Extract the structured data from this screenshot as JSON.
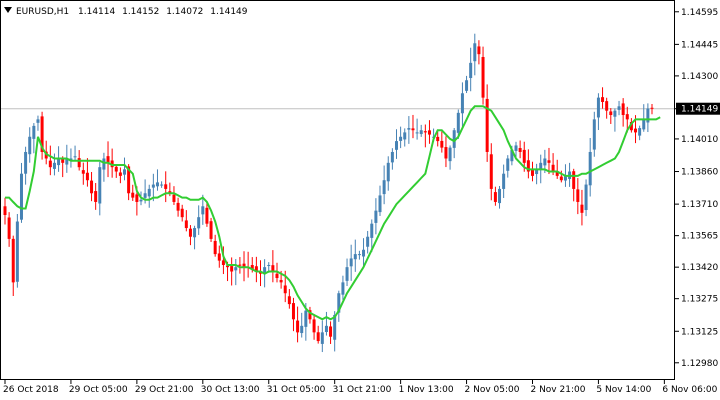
{
  "header": {
    "dropdown_icon": "triangle-down-icon",
    "symbol": "EURUSD,H1",
    "open": "1.14114",
    "high": "1.14152",
    "low": "1.14072",
    "close": "1.14149"
  },
  "colors": {
    "background": "#ffffff",
    "frame": "#000000",
    "bull_candle": "#4682b4",
    "bear_candle": "#ff0000",
    "moving_average": "#32cd32",
    "bid_line": "#c0c0c0",
    "price_label_bg": "#000000",
    "price_label_text": "#ffffff"
  },
  "chart_data": {
    "type": "candlestick",
    "title": "EURUSD,H1",
    "grid": false,
    "ylim": [
      1.1291,
      1.1464
    ],
    "y_ticks": [
      "1.14595",
      "1.14445",
      "1.14300",
      "1.14149",
      "1.14010",
      "1.13860",
      "1.13710",
      "1.13565",
      "1.13420",
      "1.13275",
      "1.13125",
      "1.12980"
    ],
    "y_tick_values": [
      1.14595,
      1.14445,
      1.143,
      1.14149,
      1.1401,
      1.1386,
      1.1371,
      1.13565,
      1.1342,
      1.13275,
      1.13125,
      1.1298
    ],
    "x_ticks": [
      "26 Oct 2018",
      "29 Oct 05:00",
      "29 Oct 21:00",
      "30 Oct 13:00",
      "31 Oct 05:00",
      "31 Oct 21:00",
      "1 Nov 13:00",
      "2 Nov 05:00",
      "2 Nov 21:00",
      "5 Nov 14:00",
      "6 Nov 06:00"
    ],
    "x_tick_bars": [
      0,
      16,
      32,
      48,
      64,
      80,
      96,
      112,
      128,
      144,
      160
    ],
    "current_price": "1.14149",
    "series": [
      {
        "kind": "close_path",
        "values": [
          1.1366,
          1.1355,
          1.1335,
          1.1363,
          1.1385,
          1.1395,
          1.1402,
          1.1407,
          1.141,
          1.1395,
          1.1392,
          1.1388,
          1.139,
          1.1392,
          1.139,
          1.1392,
          1.1392,
          1.1393,
          1.1388,
          1.1385,
          1.1382,
          1.1376,
          1.1372,
          1.1388,
          1.1392,
          1.139,
          1.1388,
          1.1386,
          1.1384,
          1.1387,
          1.1376,
          1.1374,
          1.1372,
          1.1373,
          1.1376,
          1.1378,
          1.138,
          1.1381,
          1.138,
          1.1378,
          1.1376,
          1.1372,
          1.1368,
          1.1365,
          1.136,
          1.1356,
          1.136,
          1.1365,
          1.137,
          1.1362,
          1.1355,
          1.1348,
          1.1345,
          1.1343,
          1.1342,
          1.134,
          1.1342,
          1.1343,
          1.1342,
          1.1342,
          1.1341,
          1.134,
          1.1339,
          1.1342,
          1.1343,
          1.134,
          1.1337,
          1.1335,
          1.133,
          1.1325,
          1.1318,
          1.1312,
          1.1315,
          1.1322,
          1.1318,
          1.1312,
          1.1308,
          1.1312,
          1.1315,
          1.131,
          1.132,
          1.133,
          1.1335,
          1.1342,
          1.1346,
          1.1348,
          1.1348,
          1.135,
          1.1356,
          1.1362,
          1.1368,
          1.1375,
          1.1382,
          1.139,
          1.1395,
          1.14,
          1.1402,
          1.1404,
          1.1406,
          1.1405,
          1.1404,
          1.1405,
          1.1404,
          1.1403,
          1.1402,
          1.14,
          1.1397,
          1.1392,
          1.1397,
          1.1405,
          1.1413,
          1.1422,
          1.1428,
          1.1436,
          1.1445,
          1.144,
          1.142,
          1.1395,
          1.1378,
          1.1372,
          1.1378,
          1.1385,
          1.1392,
          1.1396,
          1.1398,
          1.1395,
          1.139,
          1.1386,
          1.1384,
          1.1387,
          1.139,
          1.1392,
          1.139,
          1.1386,
          1.1384,
          1.1382,
          1.1384,
          1.1386,
          1.1378,
          1.1372,
          1.1367,
          1.138,
          1.1395,
          1.141,
          1.142,
          1.1418,
          1.1414,
          1.1412,
          1.1414,
          1.1416,
          1.1412,
          1.141,
          1.1405,
          1.1404,
          1.1406,
          1.141,
          1.1415,
          1.14149
        ]
      },
      {
        "kind": "moving_average",
        "values": [
          1.1374,
          1.1374,
          1.1372,
          1.137,
          1.1369,
          1.1369,
          1.1377,
          1.1386,
          1.1402,
          1.1397,
          1.1394,
          1.1393,
          1.1392,
          1.1392,
          1.1392,
          1.1392,
          1.1391,
          1.1391,
          1.1391,
          1.1391,
          1.1391,
          1.1391,
          1.1391,
          1.1391,
          1.139,
          1.139,
          1.1389,
          1.1389,
          1.1389,
          1.1389,
          1.1387,
          1.1385,
          1.1377,
          1.1374,
          1.1373,
          1.1373,
          1.1374,
          1.1374,
          1.1375,
          1.1376,
          1.1376,
          1.1376,
          1.1375,
          1.1374,
          1.1374,
          1.1373,
          1.1373,
          1.1373,
          1.1374,
          1.1372,
          1.1368,
          1.1363,
          1.1356,
          1.1347,
          1.1343,
          1.1343,
          1.1343,
          1.1342,
          1.1342,
          1.1342,
          1.1341,
          1.134,
          1.134,
          1.1339,
          1.134,
          1.134,
          1.134,
          1.1339,
          1.1338,
          1.1336,
          1.1333,
          1.1329,
          1.1326,
          1.1323,
          1.1321,
          1.132,
          1.1319,
          1.1318,
          1.1319,
          1.1318,
          1.1319,
          1.1322,
          1.1326,
          1.133,
          1.1333,
          1.1336,
          1.1339,
          1.1342,
          1.1346,
          1.135,
          1.1354,
          1.1358,
          1.1362,
          1.1365,
          1.1368,
          1.1371,
          1.1373,
          1.1375,
          1.1377,
          1.1379,
          1.1381,
          1.1383,
          1.1385,
          1.1393,
          1.1401,
          1.1405,
          1.1405,
          1.1403,
          1.1401,
          1.14,
          1.1402,
          1.1406,
          1.141,
          1.1414,
          1.1416,
          1.1416,
          1.1416,
          1.1415,
          1.1414,
          1.1411,
          1.1408,
          1.1405,
          1.14,
          1.1396,
          1.1392,
          1.139,
          1.1388,
          1.1387,
          1.1387,
          1.1387,
          1.1387,
          1.1387,
          1.1386,
          1.1386,
          1.1386,
          1.1385,
          1.1384,
          1.1384,
          1.1384,
          1.1384,
          1.1385,
          1.1385,
          1.1386,
          1.1387,
          1.1388,
          1.1389,
          1.139,
          1.1391,
          1.1392,
          1.1395,
          1.14,
          1.1405,
          1.1408,
          1.141,
          1.141,
          1.141,
          1.141,
          1.141,
          1.141,
          1.1411
        ]
      }
    ]
  }
}
